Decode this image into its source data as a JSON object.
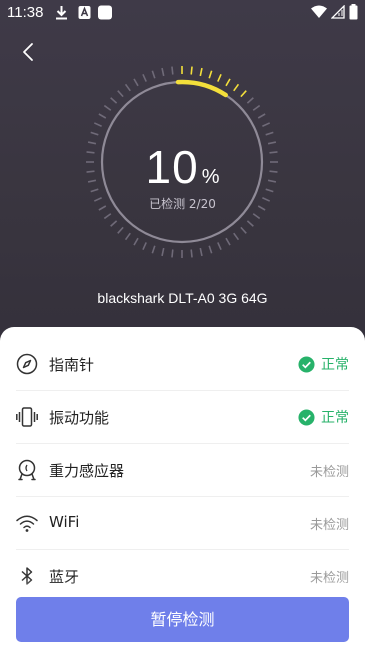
{
  "status_bar": {
    "time": "11:38"
  },
  "progress": {
    "percent_value": "10",
    "percent_unit": "%",
    "checked_text": "已检测 2/20",
    "fraction": 0.1
  },
  "device": {
    "name": "blackshark DLT-A0 3G 64G"
  },
  "items": [
    {
      "label": "指南针",
      "status": "正常",
      "state": "ok",
      "icon": "compass-icon"
    },
    {
      "label": "振动功能",
      "status": "正常",
      "state": "ok",
      "icon": "vibration-icon"
    },
    {
      "label": "重力感应器",
      "status": "未检测",
      "state": "pending",
      "icon": "gravity-sensor-icon"
    },
    {
      "label": "WiFi",
      "status": "未检测",
      "state": "pending",
      "icon": "wifi-icon"
    },
    {
      "label": "蓝牙",
      "status": "未检测",
      "state": "pending",
      "icon": "bluetooth-icon"
    }
  ],
  "actions": {
    "pause_label": "暂停检测"
  },
  "colors": {
    "accent": "#6f7fea",
    "ok": "#27b26a",
    "gauge_active": "#f3df3b",
    "header_bg": "#3d3845"
  }
}
